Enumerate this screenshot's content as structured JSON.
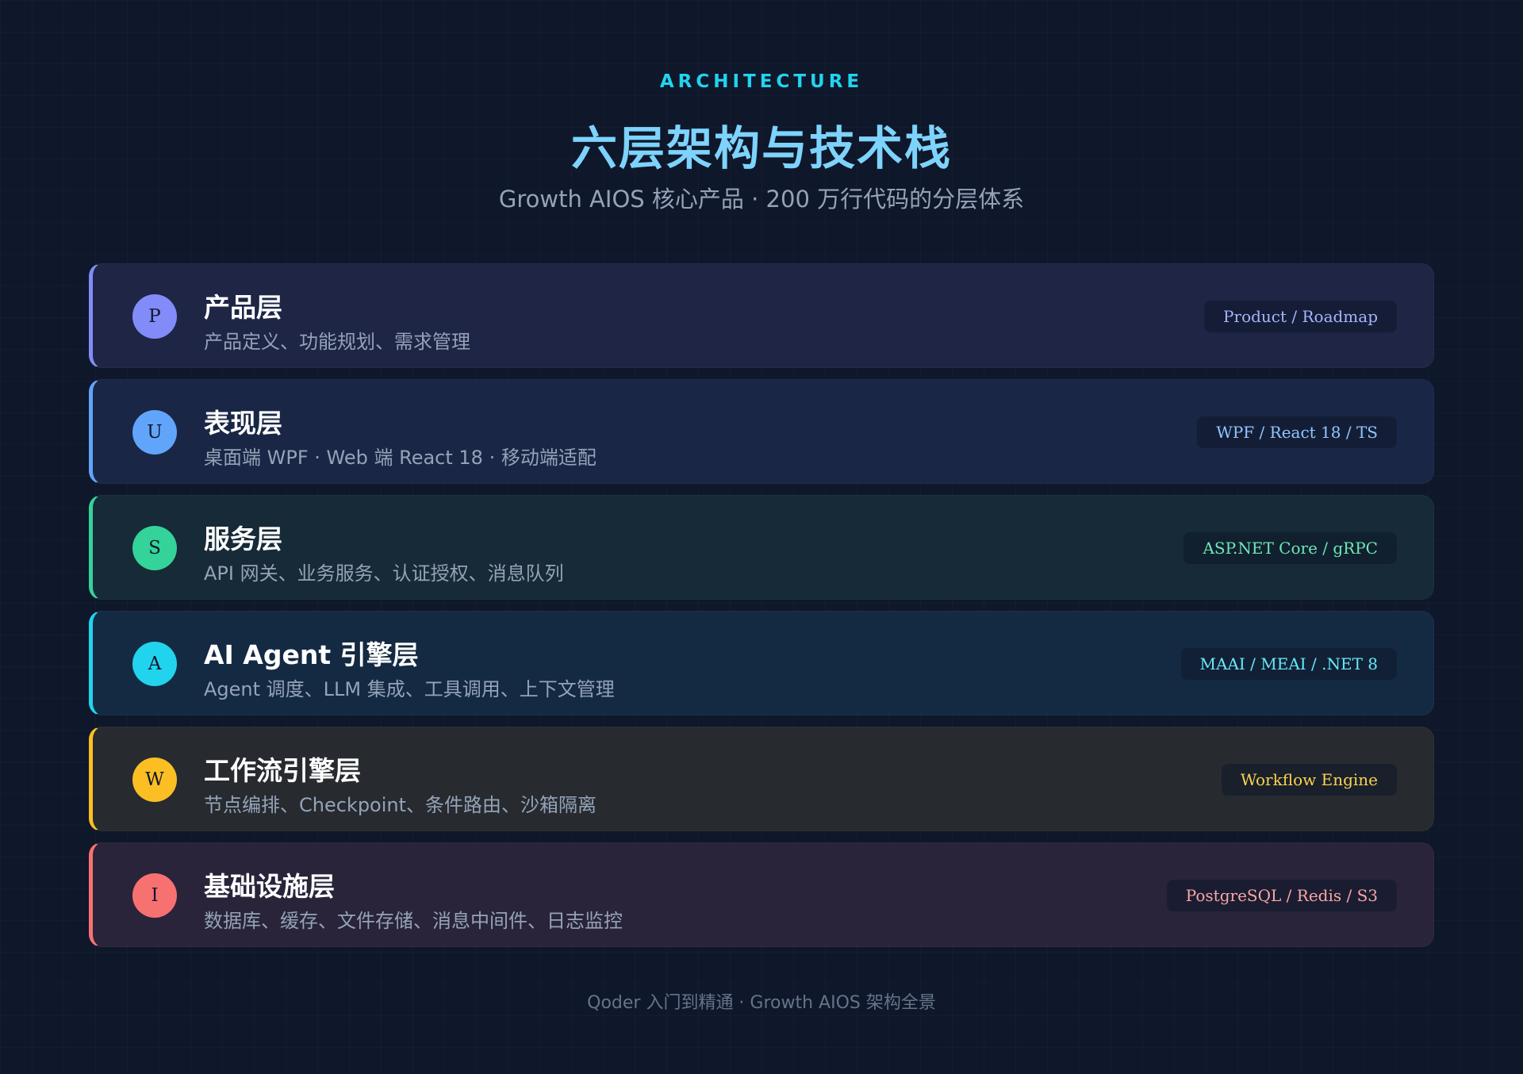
{
  "header": {
    "eyebrow": "ARCHITECTURE",
    "title": "六层架构与技术栈",
    "subtitle": "Growth AIOS 核心产品 · 200 万行代码的分层体系"
  },
  "layers": [
    {
      "badge": "P",
      "title": "产品层",
      "description": "产品定义、功能规划、需求管理",
      "tech": "Product / Roadmap",
      "accent": "#818cf8",
      "background": "#1e2545",
      "tag_color": "#a5b4fc"
    },
    {
      "badge": "U",
      "title": "表现层",
      "description": "桌面端 WPF · Web 端 React 18 · 移动端适配",
      "tech": "WPF / React 18 / TS",
      "accent": "#60a5fa",
      "background": "#1a2645",
      "tag_color": "#93c5fd"
    },
    {
      "badge": "S",
      "title": "服务层",
      "description": "API 网关、业务服务、认证授权、消息队列",
      "tech": "ASP.NET Core / gRPC",
      "accent": "#34d399",
      "background": "#162a37",
      "tag_color": "#6ee7b7"
    },
    {
      "badge": "A",
      "title": "AI Agent 引擎层",
      "description": "Agent 调度、LLM 集成、工具调用、上下文管理",
      "tech": "MAAI / MEAI / .NET 8",
      "accent": "#22d3ee",
      "background": "#142a43",
      "tag_color": "#67e8f9"
    },
    {
      "badge": "W",
      "title": "工作流引擎层",
      "description": "节点编排、Checkpoint、条件路由、沙箱隔离",
      "tech": "Workflow Engine",
      "accent": "#fbbf24",
      "background": "#272a2f",
      "tag_color": "#fcd34d"
    },
    {
      "badge": "I",
      "title": "基础设施层",
      "description": "数据库、缓存、文件存储、消息中间件、日志监控",
      "tech": "PostgreSQL / Redis / S3",
      "accent": "#f87171",
      "background": "#29243a",
      "tag_color": "#fca5a5"
    }
  ],
  "footer": "Qoder 入门到精通 · Growth AIOS 架构全景"
}
